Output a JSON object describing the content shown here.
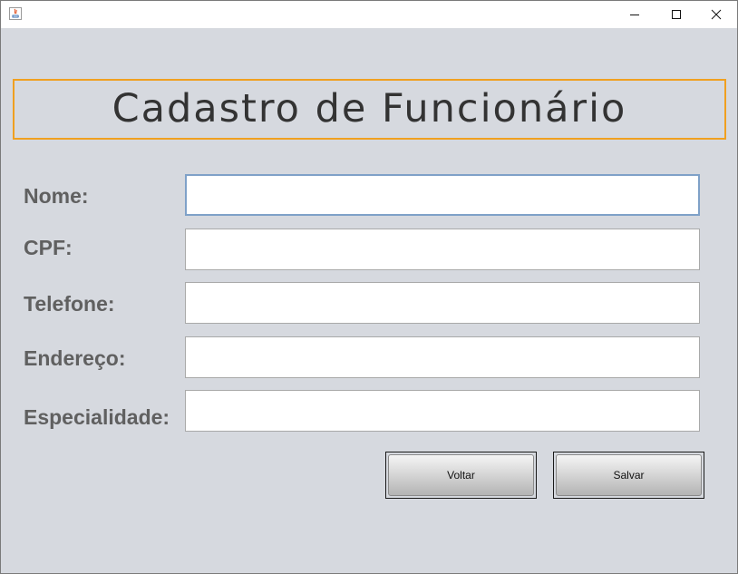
{
  "window": {
    "title": "",
    "controls": {
      "minimize": "minimize",
      "maximize": "maximize",
      "close": "close"
    }
  },
  "header": {
    "title": "Cadastro de Funcionário"
  },
  "form": {
    "fields": [
      {
        "label": "Nome:",
        "value": "",
        "placeholder": ""
      },
      {
        "label": "CPF:",
        "value": "",
        "placeholder": ""
      },
      {
        "label": "Telefone:",
        "value": "",
        "placeholder": ""
      },
      {
        "label": "Endereço:",
        "value": "",
        "placeholder": ""
      },
      {
        "label": "Especialidade:",
        "value": "",
        "placeholder": ""
      }
    ]
  },
  "buttons": {
    "back_label": "Voltar",
    "save_label": "Salvar"
  },
  "colors": {
    "header_border": "#f0a020",
    "background": "#d6d9df",
    "label": "#606060",
    "focus_border": "#7fa1c8"
  },
  "icons": [
    "java-app-icon",
    "minimize-icon",
    "maximize-icon",
    "close-icon"
  ]
}
